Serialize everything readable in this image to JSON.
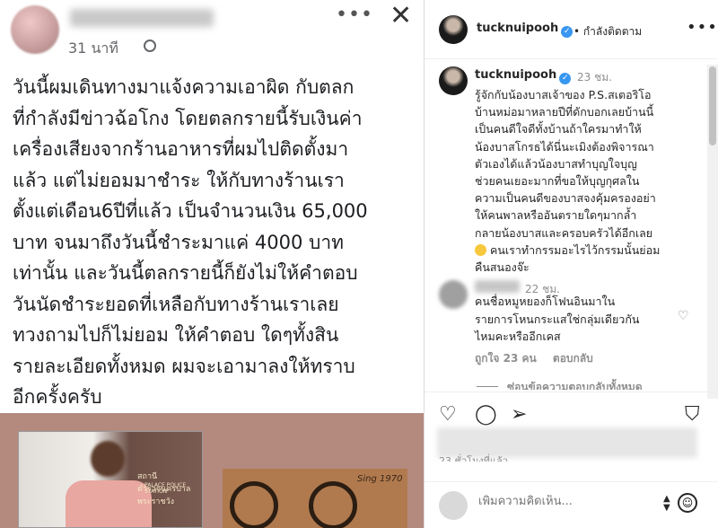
{
  "facebook": {
    "post_time": "31 นาที",
    "privacy_icon": "globe-icon",
    "more_label": "•••",
    "close_label": "✕",
    "text_lines": [
      "วันนี้ผมเดินทางมาแจ้งความเอาผิด กับตลก",
      "ที่กำลังมีข่าวฉ้อโกง โดยตลกรายนี้รับเงินค่า",
      "เครื่องเสียงจากร้านอาหารที่ผมไปติดตั้งมา",
      "แล้ว แต่ไม่ยอมมาชำระ ให้กับทางร้านเรา",
      "ตั้งแต่เดือน6ปีที่แล้ว เป็นจำนวนเงิน 65,000",
      "บาท จนมาถึงวันนี้ชำระมาแค่ 4000 บาท",
      "เท่านั้น และวันนี้ตลกรายนี้ก็ยังไม่ให้คำตอบ",
      "วันนัดชำระยอดที่เหลือกับทางร้านเราเลย",
      "ทวงถามไปก็ไม่ยอม ให้คำตอบ ใดๆทั้งสิน",
      "รายละเอียดทั้งหมด ผมจะเอามาลงให้ทราบ",
      "อีกครั้งครับ"
    ],
    "image1_sign": "สถานีตำรวจนครบาลพระราชวัง",
    "image1_sign_en": "PALACE POLICE STATION",
    "image2_logo": "Sing 1970"
  },
  "instagram": {
    "header_username": "tucknuipooh",
    "following_label": "• กำลังติดตาม",
    "more_label": "•••",
    "caption_username": "tucknuipooh",
    "caption_time": "23 ชม.",
    "caption_lines": [
      "รู้จักกับน้องบาสเจ้าของ P.S.สเตอริโอ",
      "บ้านหม่อมาหลายปีที่ดักบอกเลยบ้านนี้",
      "เป็นคนดีใจดีทั้งบ้านถ้าใครมาทำให้",
      "น้องบาสโกรธได้นี่นะเมิงต้องพิจารณา",
      "ตัวเองได้แล้วน้องบาสทำบุญใจบุญ",
      "ช่วยคนเยอะมากที่ขอให้บุญกุศลใน",
      "ความเป็นคนดีของบาสจงคุ้มครองอย่า",
      "ให้คนพาลหรืออันตรายใดๆมากล้ำ",
      "กลายน้องบาสและครอบครัวได้อีกเลย",
      "คนเราทำกรรมอะไรไว้กรรมนั้นย่อม",
      "คืนสนองจ๊ะ"
    ],
    "comment_time": "22 ชม.",
    "comment_lines": [
      "คนชื่อหมูหยองก็โฟนอินมาใน",
      "รายการโหนกระแสใช่กลุ่มเดียวกัน",
      "ไหมคะหรืออีกเคส"
    ],
    "comment_likes": "ถูกใจ 23 คน",
    "comment_reply": "ตอบกลับ",
    "view_replies": "ซ่อนข้อความตอบกลับทั้งหมด",
    "likes_time": "23 ชั่วโมงที่แล้ว",
    "add_comment_placeholder": "เพิ่มความคิดเห็น...",
    "action_icons": [
      "heart-icon",
      "comment-icon",
      "share-icon",
      "bookmark-icon"
    ]
  }
}
